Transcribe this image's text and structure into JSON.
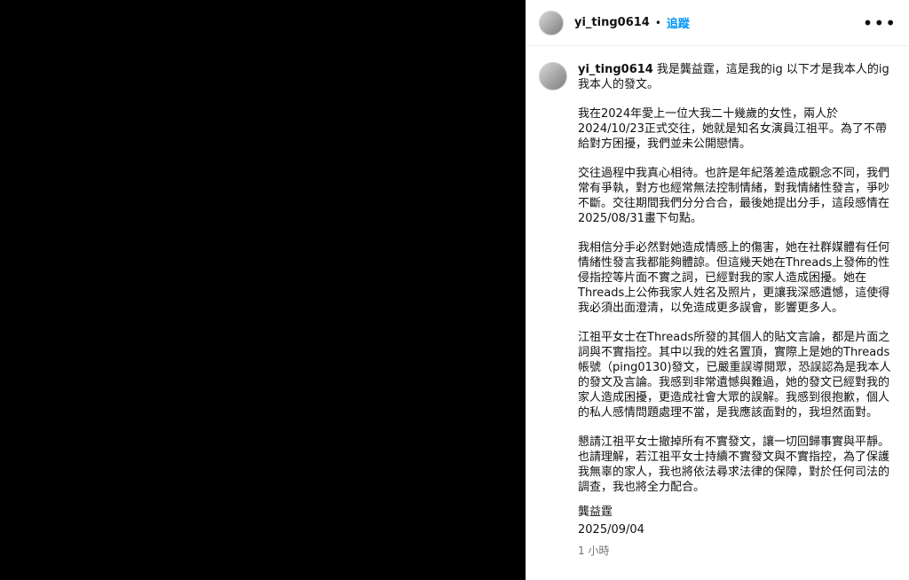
{
  "header": {
    "username": "yi_ting0614",
    "dot": "•",
    "follow_label": "追蹤",
    "more_icon_glyph": "•••"
  },
  "caption": {
    "username": "yi_ting0614",
    "first_line": "我是龔益霆，這是我的ig 以下才是我本人的ig我本人的發文。",
    "paragraphs": [
      "我在2024年愛上一位大我二十幾歲的女性，兩人於2024/10/23正式交往，她就是知名女演員江祖平。為了不帶給對方困擾，我們並未公開戀情。",
      "交往過程中我真心相待。也許是年紀落差造成觀念不同，我們常有爭執，對方也經常無法控制情緒，對我情緒性發言，爭吵不斷。交往期間我們分分合合，最後她提出分手，這段感情在2025/08/31畫下句點。",
      "我相信分手必然對她造成情感上的傷害，她在社群媒體有任何情緒性發言我都能夠體諒。但這幾天她在Threads上發佈的性侵指控等片面不實之詞，已經對我的家人造成困擾。她在Threads上公佈我家人姓名及照片，更讓我深感遺憾，這使得我必須出面澄清，以免造成更多誤會，影響更多人。",
      "江祖平女士在Threads所發的其個人的貼文言論，都是片面之詞與不實指控。其中以我的姓名置頂，實際上是她的Threads帳號（ping0130)發文，已嚴重誤導閱眾，恐誤認為是我本人的發文及言論。我感到非常遺憾與難過，她的發文已經對我的家人造成困擾，更造成社會大眾的誤解。我感到很抱歉，個人的私人感情問題處理不當，是我應該面對的，我坦然面對。",
      "懇請江祖平女士撤掉所有不實發文，讓一切回歸事實與平靜。也請理解，若江祖平女士持續不實發文與不實指控，為了保護我無辜的家人，我也將依法尋求法律的保障，對於任何司法的調查，我也將全力配合。"
    ],
    "signature_name": "龔益霆",
    "signature_date": "2025/09/04",
    "time_ago": "1 小時"
  },
  "icons": {
    "avatar_header": "avatar",
    "avatar_caption": "avatar",
    "more": "more-options-icon"
  }
}
